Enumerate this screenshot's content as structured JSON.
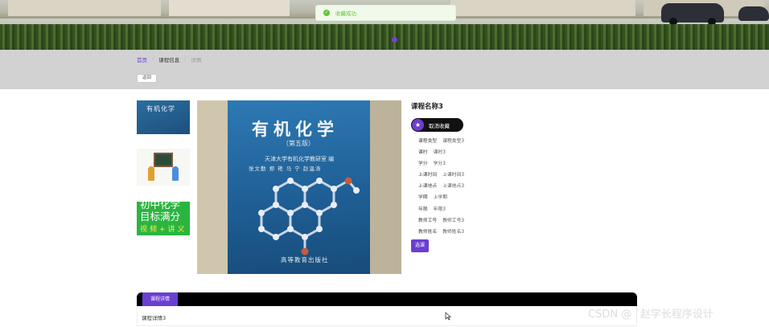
{
  "toast": {
    "message": "收藏成功"
  },
  "breadcrumb": {
    "home": "首页",
    "section": "课程信息",
    "current": "详情",
    "separator": "/"
  },
  "toolbar": {
    "back_label": "返回"
  },
  "gallery": {
    "thumb1_text": "有机化学",
    "thumb3_lines": [
      "初中化学",
      "目标满分",
      "视频+讲义"
    ]
  },
  "main_image": {
    "title": "有机化学",
    "edition": "（第五版）",
    "publisher": "天津大学有机化学教研室  编",
    "authors": "张文勤  郑  艳  马  宁  赵温涛",
    "press": "高等教育出版社"
  },
  "course": {
    "name": "课程名称3",
    "favorite_label": "取消收藏",
    "fields": [
      {
        "key": "课程类型",
        "value": "课程类型3"
      },
      {
        "key": "课时",
        "value": "课时3"
      },
      {
        "key": "学分",
        "value": "学分3"
      },
      {
        "key": "上课时间",
        "value": "上课时间3"
      },
      {
        "key": "上课地点",
        "value": "上课地点3"
      },
      {
        "key": "学期",
        "value": "上学期"
      },
      {
        "key": "年限",
        "value": "年限3"
      },
      {
        "key": "教师工号",
        "value": "教师工号3"
      },
      {
        "key": "教师姓名",
        "value": "教师姓名3"
      }
    ],
    "select_label": "选课"
  },
  "tabs": {
    "active_label": "课程详情",
    "content": "课程详情3"
  },
  "watermark": "CSDN @ `赵学长程序设计",
  "colors": {
    "accent": "#6a3fd0",
    "success": "#67c23a",
    "tabbar": "#000000"
  }
}
